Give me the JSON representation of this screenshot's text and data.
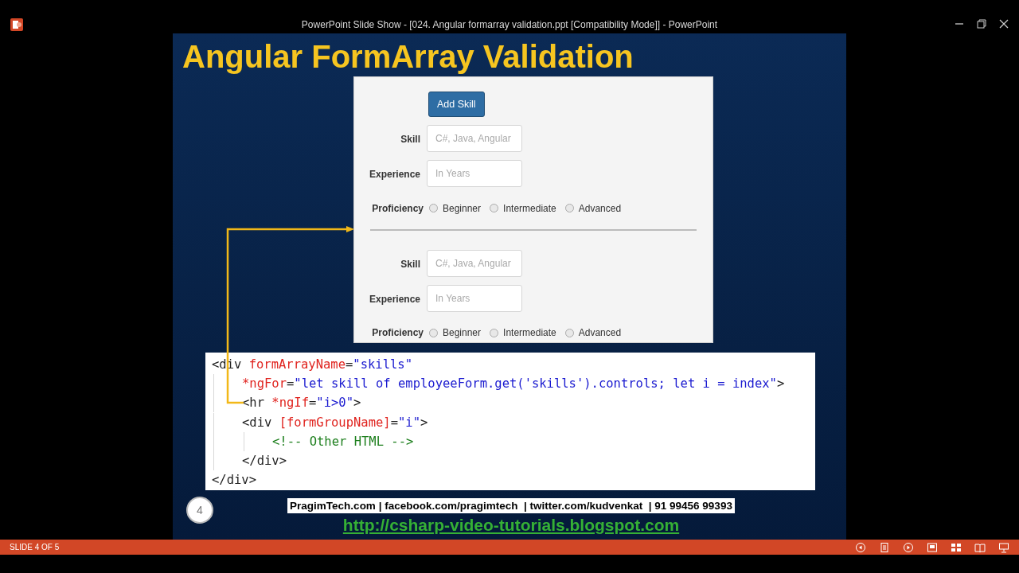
{
  "window": {
    "title": "PowerPoint Slide Show - [024. Angular formarray validation.ppt [Compatibility Mode]] - PowerPoint"
  },
  "slide": {
    "title": "Angular FormArray Validation",
    "form": {
      "add_button": "Add Skill",
      "groups": [
        {
          "skill": {
            "label": "Skill",
            "placeholder": "C#, Java, Angular"
          },
          "experience": {
            "label": "Experience",
            "placeholder": "In Years"
          },
          "proficiency": {
            "label": "Proficiency",
            "options": [
              {
                "label": "Beginner",
                "selected": false
              },
              {
                "label": "Intermediate",
                "selected": false
              },
              {
                "label": "Advanced",
                "selected": false
              }
            ]
          }
        },
        {
          "skill": {
            "label": "Skill",
            "placeholder": "C#, Java, Angular"
          },
          "experience": {
            "label": "Experience",
            "placeholder": "In Years"
          },
          "proficiency": {
            "label": "Proficiency",
            "options": [
              {
                "label": "Beginner",
                "selected": false
              },
              {
                "label": "Intermediate",
                "selected": false
              },
              {
                "label": "Advanced",
                "selected": false
              }
            ]
          }
        }
      ]
    },
    "code": [
      {
        "tokens": [
          {
            "text": "<div ",
            "kind": "tag"
          },
          {
            "text": "formArrayName",
            "kind": "attr"
          },
          {
            "text": "=",
            "kind": "tag"
          },
          {
            "text": "\"skills\"",
            "kind": "value"
          }
        ],
        "children": [
          {
            "tokens": [
              {
                "text": "*ngFor",
                "kind": "attr"
              },
              {
                "text": "=",
                "kind": "tag"
              },
              {
                "text": "\"let skill of employeeForm.get('skills').controls; let i = index\"",
                "kind": "value"
              },
              {
                "text": ">",
                "kind": "tag"
              }
            ]
          },
          {
            "tokens": [
              {
                "text": "<hr ",
                "kind": "tag"
              },
              {
                "text": "*ngIf",
                "kind": "attr"
              },
              {
                "text": "=",
                "kind": "tag"
              },
              {
                "text": "\"i>0\"",
                "kind": "value"
              },
              {
                "text": ">",
                "kind": "tag"
              }
            ]
          },
          {
            "tokens": [
              {
                "text": "<div ",
                "kind": "tag"
              },
              {
                "text": "[formGroupName]",
                "kind": "attr"
              },
              {
                "text": "=",
                "kind": "tag"
              },
              {
                "text": "\"i\"",
                "kind": "value"
              },
              {
                "text": ">",
                "kind": "tag"
              }
            ],
            "children": [
              {
                "tokens": [
                  {
                    "text": "<!-- Other HTML -->",
                    "kind": "comment"
                  }
                ]
              }
            ]
          },
          {
            "tokens": [
              {
                "text": "</div>",
                "kind": "tag"
              }
            ]
          }
        ]
      },
      {
        "tokens": [
          {
            "text": "</div>",
            "kind": "tag"
          }
        ]
      }
    ],
    "slide_number": "4",
    "contact": "PragimTech.com | facebook.com/pragimtech  | twitter.com/kudvenkat  | 91 99456 99393",
    "link": "http://csharp-video-tutorials.blogspot.com"
  },
  "status_bar": {
    "slide_counter": "SLIDE 4 OF 5"
  }
}
